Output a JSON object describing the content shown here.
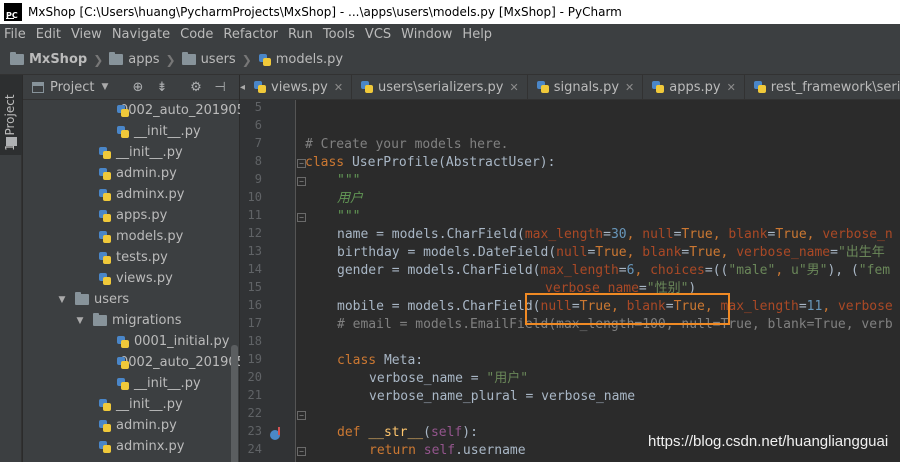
{
  "window": {
    "app_logo": "PC",
    "title": "MxShop [C:\\Users\\huang\\PycharmProjects\\MxShop] - ...\\apps\\users\\models.py [MxShop] - PyCharm"
  },
  "menu": [
    "File",
    "Edit",
    "View",
    "Navigate",
    "Code",
    "Refactor",
    "Run",
    "Tools",
    "VCS",
    "Window",
    "Help"
  ],
  "breadcrumb": [
    "MxShop",
    "apps",
    "users",
    "models.py"
  ],
  "side_tool": {
    "label": "1: Project"
  },
  "project": {
    "title": "Project",
    "tree": [
      "0002_auto_201905",
      "__init__.py",
      "__init__.py",
      "admin.py",
      "adminx.py",
      "apps.py",
      "models.py",
      "tests.py",
      "views.py",
      "users",
      "migrations",
      "0001_initial.py",
      "0002_auto_201905",
      "__init__.py",
      "__init__.py",
      "admin.py",
      "adminx.py"
    ]
  },
  "tabs": [
    "views.py",
    "users\\serializers.py",
    "signals.py",
    "apps.py",
    "rest_framework\\serializers.py"
  ],
  "line_numbers": [
    "5",
    "6",
    "7",
    "8",
    "9",
    "10",
    "11",
    "12",
    "13",
    "14",
    "15",
    "16",
    "17",
    "18",
    "19",
    "20",
    "21",
    "22",
    "23",
    "24"
  ],
  "code": {
    "l7_comment": "# Create your models here.",
    "l8_kw": "class",
    "l8_name": "UserProfile",
    "l8_rest": "(AbstractUser):",
    "l9_doc": "\"\"\"",
    "l10_doc": "用户",
    "l11_doc": "\"\"\"",
    "l12_a": "name = models.CharField(",
    "l12_p1": "max_length",
    "l12_eq1": "=",
    "l12_v1": "30",
    "l12_c1": ", ",
    "l12_p2": "null",
    "l12_eq2": "=",
    "l12_v2": "True",
    "l12_c2": ", ",
    "l12_p3": "blank",
    "l12_eq3": "=",
    "l12_v3": "True",
    "l12_c3": ", ",
    "l12_p4": "verbose_n",
    "l13_a": "birthday = models.DateField(",
    "l13_p1": "null",
    "l13_eq1": "=",
    "l13_v1": "True",
    "l13_c1": ", ",
    "l13_p2": "blank",
    "l13_eq2": "=",
    "l13_v2": "True",
    "l13_c2": ", ",
    "l13_p3": "verbose_name",
    "l13_eq3": "=",
    "l13_s3": "\"出生年",
    "l14_a": "gender = models.CharField(",
    "l14_p1": "max_length",
    "l14_eq1": "=",
    "l14_v1": "6",
    "l14_c1": ", ",
    "l14_p2": "choices",
    "l14_eq2": "=((",
    "l14_s1": "\"male\"",
    "l14_c2": ", ",
    "l14_s2": "u\"男\"",
    "l14_c3": "), (",
    "l14_s3": "\"fem",
    "l15_p1": "verbose_name",
    "l15_eq1": "=",
    "l15_s1": "\"性别\"",
    "l15_end": ")",
    "l16_a": "mobile = models.CharField(",
    "l16_p1": "null",
    "l16_eq1": "=",
    "l16_v1": "True",
    "l16_c1": ", ",
    "l16_p2": "blank",
    "l16_eq2": "=",
    "l16_v2": "True",
    "l16_c2": ", ",
    "l16_p3": "max_length",
    "l16_eq3": "=",
    "l16_v3": "11",
    "l16_c3": ", ",
    "l16_p4": "verbose",
    "l17_comment": "# email = models.EmailField(max_length=100, null=True, blank=True, verb",
    "l19_kw": "class",
    "l19_rest": " Meta:",
    "l20_a": "verbose_name = ",
    "l20_s": "\"用户\"",
    "l21_a": "verbose_name_plural = verbose_name",
    "l23_kw": "def",
    "l23_fn": "__str__",
    "l23_open": "(",
    "l23_self": "self",
    "l23_close": "):",
    "l24_kw": "return",
    "l24_self": "self",
    "l24_rest": ".username"
  },
  "watermark": "https://blog.csdn.net/huangliangguai"
}
